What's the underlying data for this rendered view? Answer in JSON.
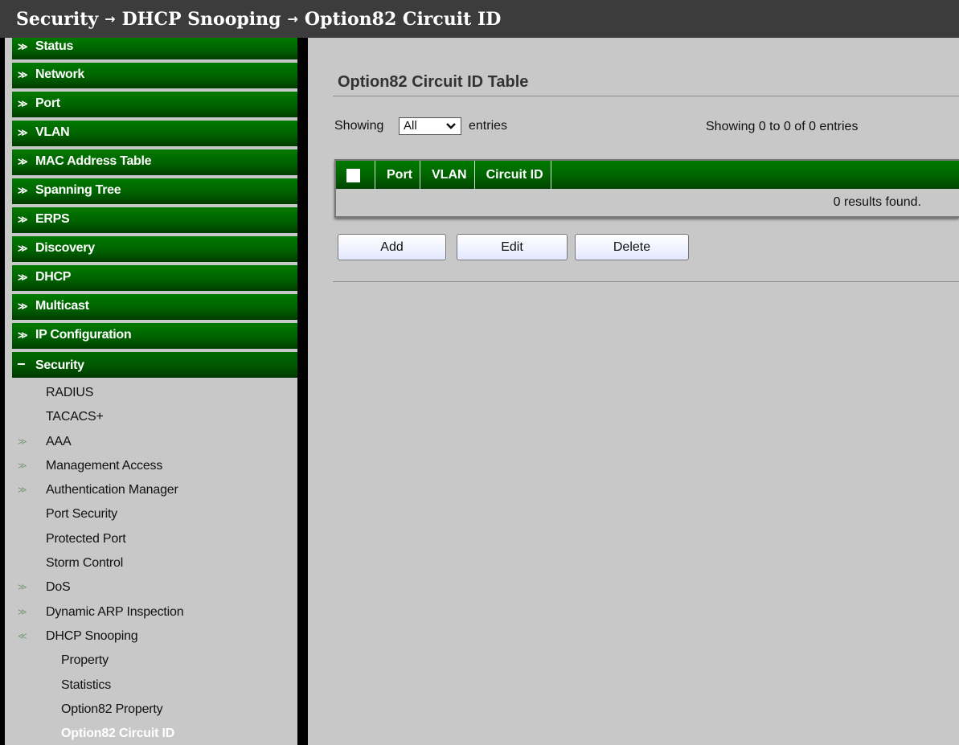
{
  "breadcrumb": {
    "items": [
      "Security",
      "DHCP Snooping",
      "Option82 Circuit ID"
    ],
    "separator": "→"
  },
  "sidebar": {
    "menu": [
      {
        "label": "Status",
        "expander": "≫"
      },
      {
        "label": "Network",
        "expander": "≫"
      },
      {
        "label": "Port",
        "expander": "≫"
      },
      {
        "label": "VLAN",
        "expander": "≫"
      },
      {
        "label": "MAC Address Table",
        "expander": "≫"
      },
      {
        "label": "Spanning Tree",
        "expander": "≫"
      },
      {
        "label": "ERPS",
        "expander": "≫"
      },
      {
        "label": "Discovery",
        "expander": "≫"
      },
      {
        "label": "DHCP",
        "expander": "≫"
      },
      {
        "label": "Multicast",
        "expander": "≫"
      },
      {
        "label": "IP Configuration",
        "expander": "≫"
      },
      {
        "label": "Security",
        "expander": "−"
      }
    ],
    "security_submenu": [
      {
        "label": "RADIUS",
        "bullet": ""
      },
      {
        "label": "TACACS+",
        "bullet": ""
      },
      {
        "label": "AAA",
        "bullet": "≫"
      },
      {
        "label": "Management Access",
        "bullet": "≫"
      },
      {
        "label": "Authentication Manager",
        "bullet": "≫"
      },
      {
        "label": "Port Security",
        "bullet": ""
      },
      {
        "label": "Protected Port",
        "bullet": ""
      },
      {
        "label": "Storm Control",
        "bullet": ""
      },
      {
        "label": "DoS",
        "bullet": "≫"
      },
      {
        "label": "Dynamic ARP Inspection",
        "bullet": "≫"
      },
      {
        "label": "DHCP Snooping",
        "bullet": "≪"
      }
    ],
    "dhcp_snooping_submenu": [
      {
        "label": "Property"
      },
      {
        "label": "Statistics"
      },
      {
        "label": "Option82 Property"
      },
      {
        "label": "Option82 Circuit ID"
      }
    ]
  },
  "main": {
    "title": "Option82 Circuit ID Table",
    "showing_label": "Showing",
    "entries_select": "All",
    "entries_label": "entries",
    "showing_info": "Showing 0 to 0 of 0 entries",
    "table": {
      "columns": [
        "Port",
        "VLAN",
        "Circuit ID"
      ],
      "empty_message": "0 results found."
    },
    "buttons": {
      "add": "Add",
      "edit": "Edit",
      "delete": "Delete"
    }
  },
  "colors": {
    "menu_green": "#006200",
    "background": "#c8c8c8",
    "title_bar": "#3c3c3c"
  }
}
